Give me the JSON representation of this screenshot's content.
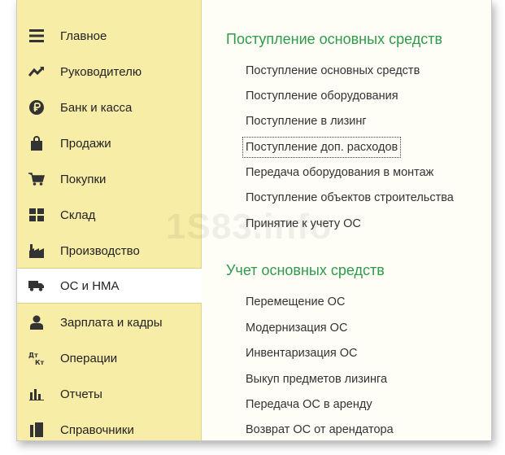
{
  "sidebar": {
    "items": [
      {
        "label": "Главное",
        "icon": "menu-icon"
      },
      {
        "label": "Руководителю",
        "icon": "trend-chart-icon"
      },
      {
        "label": "Банк и касса",
        "icon": "ruble-coin-icon"
      },
      {
        "label": "Продажи",
        "icon": "shopping-bag-icon"
      },
      {
        "label": "Покупки",
        "icon": "shopping-cart-icon"
      },
      {
        "label": "Склад",
        "icon": "warehouse-grid-icon"
      },
      {
        "label": "Производство",
        "icon": "factory-icon"
      },
      {
        "label": "ОС и НМА",
        "icon": "truck-icon",
        "active": true
      },
      {
        "label": "Зарплата и кадры",
        "icon": "person-icon"
      },
      {
        "label": "Операции",
        "icon": "debit-credit-icon"
      },
      {
        "label": "Отчеты",
        "icon": "bar-chart-icon"
      },
      {
        "label": "Справочники",
        "icon": "books-icon"
      }
    ]
  },
  "main": {
    "sections": [
      {
        "title": "Поступление основных средств",
        "links": [
          "Поступление основных средств",
          "Поступление оборудования",
          "Поступление в лизинг",
          "Поступление доп. расходов",
          "Передача оборудования в монтаж",
          "Поступление объектов строительства",
          "Принятие к учету ОС"
        ]
      },
      {
        "title": "Учет основных средств",
        "links": [
          "Перемещение ОС",
          "Модернизация ОС",
          "Инвентаризация ОС",
          "Выкуп предметов лизинга",
          "Передача ОС в аренду",
          "Возврат ОС от арендатора"
        ]
      }
    ]
  },
  "watermark": "1S83.info",
  "colors": {
    "sidebar_bg": "#f8eda6",
    "section_title": "#2f9a4c",
    "content_bg": "#fffef6"
  }
}
